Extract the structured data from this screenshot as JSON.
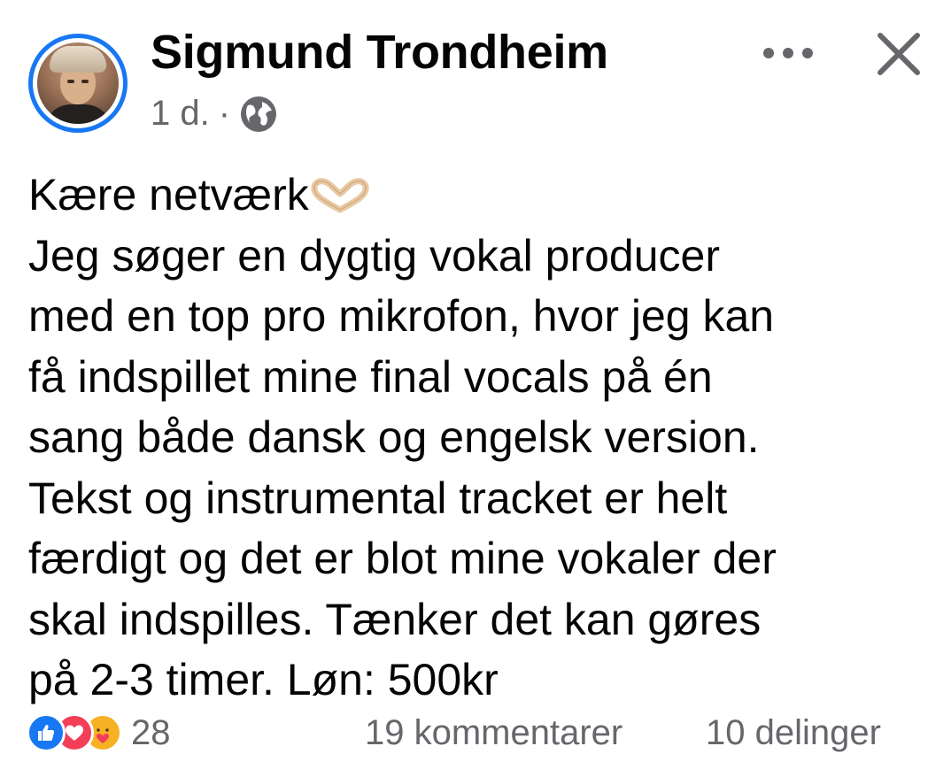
{
  "post": {
    "author": "Sigmund Trondheim",
    "time": "1 d.",
    "separator": "·",
    "privacy_icon": "globe-icon",
    "more_icon": "more-options-icon",
    "close_icon": "close-icon",
    "text_lines": [
      "Kære netværk",
      "Jeg søger en dygtig vokal producer",
      "med en top pro mikrofon, hvor jeg kan",
      "få indspillet mine final vocals på én",
      "sang både dansk og engelsk version.",
      "Tekst og instrumental tracket er helt",
      "færdigt og det er blot mine vokaler der",
      "skal indspilles. Tænker det kan gøres",
      "på 2-3 timer. Løn: 500kr"
    ],
    "emoji_after_first_line": "heart-hands-icon"
  },
  "footer": {
    "reaction_icons": [
      "like-icon",
      "love-icon",
      "care-icon"
    ],
    "reaction_count": "28",
    "comments": "19 kommentarer",
    "shares": "10 delinger"
  },
  "colors": {
    "accent": "#1877f2",
    "text": "#050505",
    "secondary_text": "#65676b",
    "love": "#f33e58",
    "care": "#f7b125"
  }
}
